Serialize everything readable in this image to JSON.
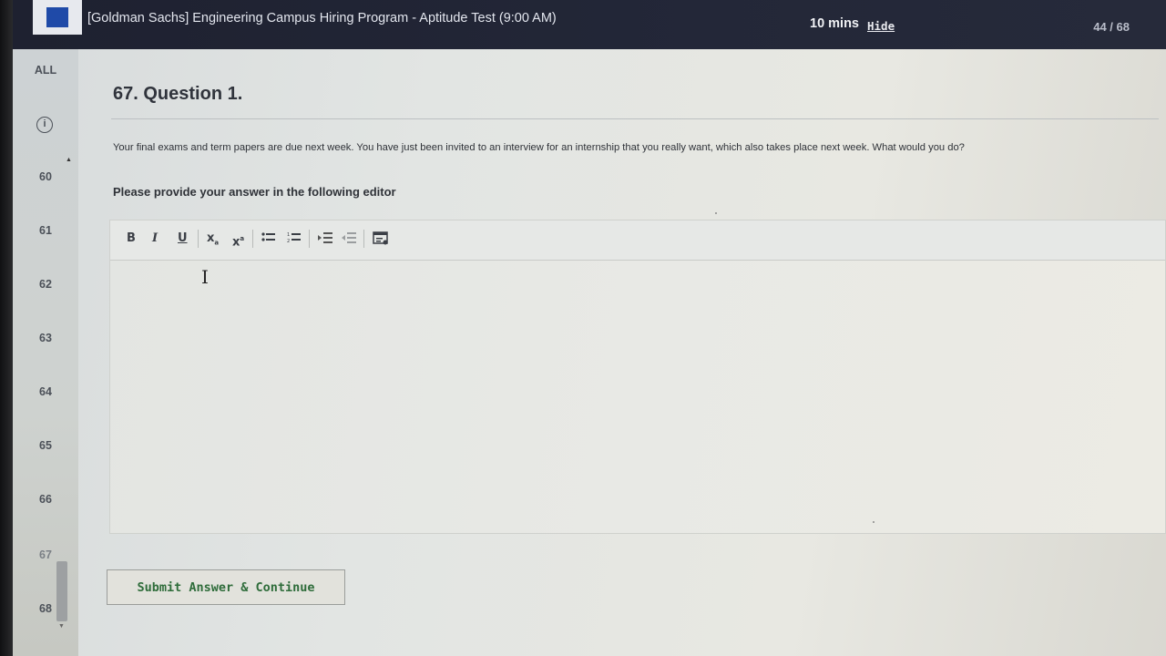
{
  "header": {
    "test_title": "[Goldman Sachs] Engineering Campus Hiring Program - Aptitude Test (9:00 AM)",
    "timer": "10 mins",
    "hide_label": "Hide",
    "progress": "44 / 68"
  },
  "sidebar": {
    "all_label": "ALL",
    "items": [
      {
        "label": "60"
      },
      {
        "label": "61"
      },
      {
        "label": "62"
      },
      {
        "label": "63"
      },
      {
        "label": "64"
      },
      {
        "label": "65"
      },
      {
        "label": "66"
      },
      {
        "label": "67"
      },
      {
        "label": "68"
      }
    ]
  },
  "question": {
    "title": "67. Question 1.",
    "text": "Your final exams and term papers are due next week. You have just been invited to an interview for an internship that you really want, which also takes place next week. What would you do?",
    "editor_label": "Please provide your answer in the following editor"
  },
  "toolbar": {
    "bold": "B",
    "italic": "I",
    "underline": "U",
    "subscript": "x",
    "superscript": "x",
    "bullet_list_icon": "bulleted-list-icon",
    "numbered_list_icon": "numbered-list-icon",
    "indent_icon": "indent-icon",
    "outdent_icon": "outdent-icon",
    "code_icon": "code-block-icon"
  },
  "editor": {
    "value": ""
  },
  "submit_label": "Submit Answer & Continue",
  "colors": {
    "topbar": "#1e2130",
    "logo": "#1f4aa8",
    "submit_text": "#2e6c3a"
  }
}
